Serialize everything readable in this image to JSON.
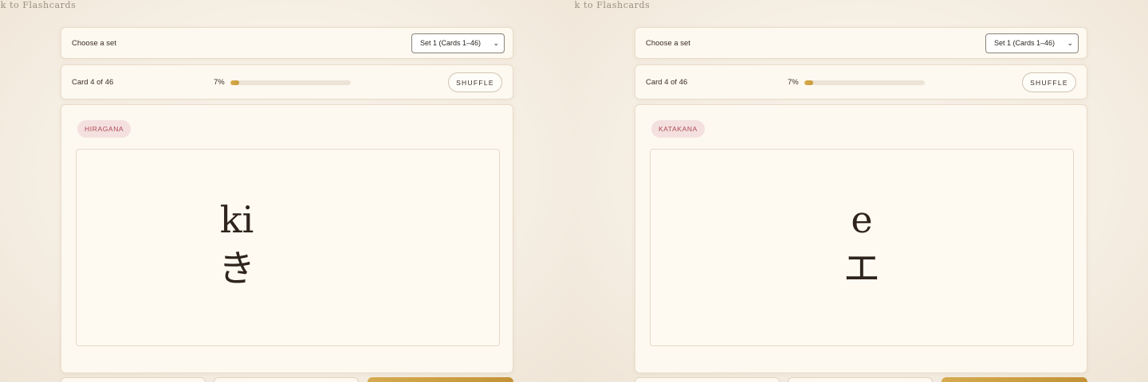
{
  "panes": [
    {
      "back_link": "Back to Flashcards",
      "set_label": "Choose a set",
      "set_selected": "Set 1 (Cards 1–46)",
      "card_count": "Card 4 of 46",
      "progress_pct": "7%",
      "progress_value": 0.07,
      "shuffle_label": "SHUFFLE",
      "script_badge": "HIRAGANA",
      "romaji": "ki",
      "kana": "き"
    },
    {
      "back_link": "Back to Flashcards",
      "set_label": "Choose a set",
      "set_selected": "Set 1 (Cards 1–46)",
      "card_count": "Card 4 of 46",
      "progress_pct": "7%",
      "progress_value": 0.07,
      "shuffle_label": "SHUFFLE",
      "script_badge": "KATAKANA",
      "romaji": "e",
      "kana": "エ"
    }
  ],
  "icons": {
    "select_chevron": "chevron-down-icon"
  },
  "colors": {
    "accent_gold": "#c99a3a",
    "badge_text": "#b04a5a",
    "badge_bg": "#f4e1df"
  }
}
